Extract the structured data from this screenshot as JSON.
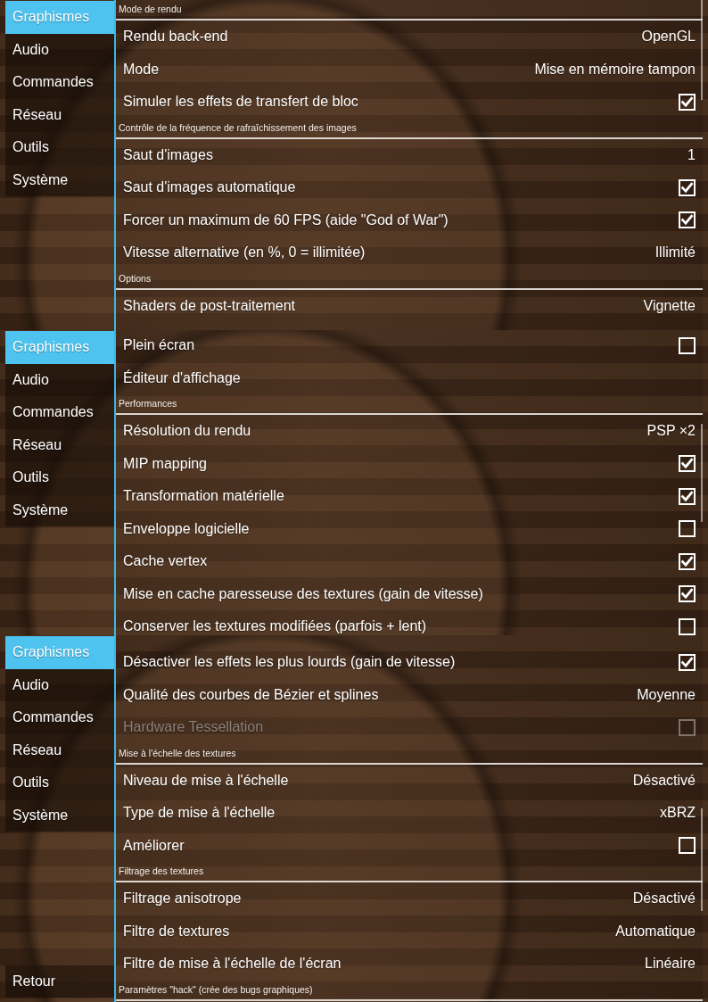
{
  "panels": [
    {
      "sidebar": {
        "items": [
          {
            "label": "Graphismes",
            "selected": true
          },
          {
            "label": "Audio",
            "selected": false
          },
          {
            "label": "Commandes",
            "selected": false
          },
          {
            "label": "Réseau",
            "selected": false
          },
          {
            "label": "Outils",
            "selected": false
          },
          {
            "label": "Système",
            "selected": false
          }
        ]
      },
      "groups": [
        {
          "header": "Mode de rendu",
          "rows": [
            {
              "kind": "value",
              "label": "Rendu back-end",
              "value": "OpenGL",
              "disabled": false
            },
            {
              "kind": "value",
              "label": "Mode",
              "value": "Mise en mémoire tampon",
              "disabled": false
            },
            {
              "kind": "checkbox",
              "label": "Simuler les effets de transfert de bloc",
              "checked": true,
              "disabled": false
            }
          ]
        },
        {
          "header": "Contrôle de la fréquence de rafraîchissement des images",
          "rows": [
            {
              "kind": "value",
              "label": "Saut d'images",
              "value": "1",
              "disabled": false
            },
            {
              "kind": "checkbox",
              "label": "Saut d'images automatique",
              "checked": true,
              "disabled": false
            },
            {
              "kind": "checkbox",
              "label": "Forcer un maximum de 60 FPS (aide \"God of War\")",
              "checked": true,
              "disabled": false
            },
            {
              "kind": "value",
              "label": "Vitesse alternative (en %, 0 = illimitée)",
              "value": "Illimité",
              "disabled": false
            }
          ]
        },
        {
          "header": "Options",
          "rows": [
            {
              "kind": "value",
              "label": "Shaders de post-traitement",
              "value": "Vignette",
              "disabled": false
            }
          ]
        }
      ]
    },
    {
      "sidebar": {
        "items": [
          {
            "label": "Graphismes",
            "selected": true
          },
          {
            "label": "Audio",
            "selected": false
          },
          {
            "label": "Commandes",
            "selected": false
          },
          {
            "label": "Réseau",
            "selected": false
          },
          {
            "label": "Outils",
            "selected": false
          },
          {
            "label": "Système",
            "selected": false
          }
        ]
      },
      "groups": [
        {
          "rows": [
            {
              "kind": "checkbox",
              "label": "Plein écran",
              "checked": false,
              "disabled": false
            },
            {
              "kind": "action",
              "label": "Éditeur d'affichage",
              "disabled": false
            }
          ]
        },
        {
          "header": "Performances",
          "rows": [
            {
              "kind": "value",
              "label": "Résolution du rendu",
              "value": "PSP ×2",
              "disabled": false
            },
            {
              "kind": "checkbox",
              "label": "MIP mapping",
              "checked": true,
              "disabled": false
            },
            {
              "kind": "checkbox",
              "label": "Transformation matérielle",
              "checked": true,
              "disabled": false
            },
            {
              "kind": "checkbox",
              "label": "Enveloppe logicielle",
              "checked": false,
              "disabled": false
            },
            {
              "kind": "checkbox",
              "label": "Cache vertex",
              "checked": true,
              "disabled": false
            },
            {
              "kind": "checkbox",
              "label": "Mise en cache paresseuse des textures (gain de vitesse)",
              "checked": true,
              "disabled": false
            },
            {
              "kind": "checkbox",
              "label": "Conserver les textures modifiées (parfois + lent)",
              "checked": false,
              "disabled": false
            }
          ]
        }
      ]
    },
    {
      "sidebar": {
        "items": [
          {
            "label": "Graphismes",
            "selected": true
          },
          {
            "label": "Audio",
            "selected": false
          },
          {
            "label": "Commandes",
            "selected": false
          },
          {
            "label": "Réseau",
            "selected": false
          },
          {
            "label": "Outils",
            "selected": false
          },
          {
            "label": "Système",
            "selected": false
          }
        ],
        "back_button": "Retour"
      },
      "groups": [
        {
          "rows": [
            {
              "kind": "checkbox",
              "label": "Désactiver les effets les plus lourds (gain de vitesse)",
              "checked": true,
              "disabled": false
            },
            {
              "kind": "value",
              "label": "Qualité des courbes de Bézier et splines",
              "value": "Moyenne",
              "disabled": false
            },
            {
              "kind": "checkbox",
              "label": "Hardware Tessellation",
              "checked": false,
              "disabled": true
            }
          ]
        },
        {
          "header": "Mise à l'échelle des textures",
          "rows": [
            {
              "kind": "value",
              "label": "Niveau de mise à l'échelle",
              "value": "Désactivé",
              "disabled": false
            },
            {
              "kind": "value",
              "label": "Type de mise à l'échelle",
              "value": "xBRZ",
              "disabled": false
            },
            {
              "kind": "checkbox",
              "label": "Améliorer",
              "checked": false,
              "disabled": false
            }
          ]
        },
        {
          "header": "Filtrage des textures",
          "rows": [
            {
              "kind": "value",
              "label": "Filtrage anisotrope",
              "value": "Désactivé",
              "disabled": false
            },
            {
              "kind": "value",
              "label": "Filtre de textures",
              "value": "Automatique",
              "disabled": false
            },
            {
              "kind": "value",
              "label": "Filtre de mise à l'échelle de l'écran",
              "value": "Linéaire",
              "disabled": false
            }
          ]
        },
        {
          "header": "Paramètres \"hack\" (crée des bugs graphiques)"
        }
      ]
    }
  ]
}
